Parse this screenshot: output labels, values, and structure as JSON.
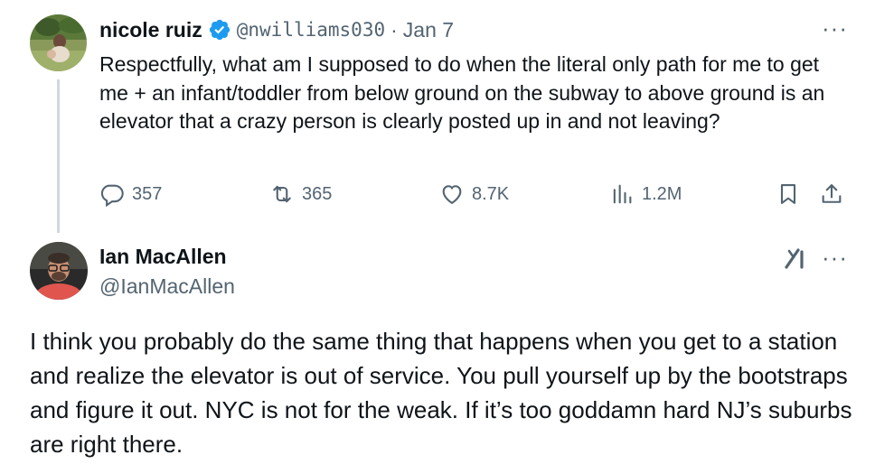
{
  "tweet1": {
    "author_name": "nicole ruiz",
    "author_handle": "@nwilliams030",
    "separator": "·",
    "date": "Jan 7",
    "more": "···",
    "text": "Respectfully, what am I supposed to do when the literal only path for me to get me + an infant/toddler from below ground on the subway to above ground is an elevator that a crazy person is clearly posted up in and not leaving?",
    "replies": "357",
    "reposts": "365",
    "likes": "8.7K",
    "views": "1.2M"
  },
  "tweet2": {
    "author_name": "Ian MacAllen",
    "author_handle": "@IanMacAllen",
    "more": "···",
    "text": "I think you probably do the same thing that happens when you get to a station and realize the elevator is out of service. You pull yourself up by the bootstraps and figure it out. NYC is not for the weak. If it’s too goddamn hard NJ’s suburbs are right there."
  },
  "colors": {
    "text_primary": "#0f1419",
    "text_secondary": "#536471",
    "verified_blue": "#1d9bf0",
    "thread_line": "#cfd9de"
  },
  "icons": [
    "verified-badge-icon",
    "reply-icon",
    "repost-icon",
    "like-icon",
    "views-icon",
    "bookmark-icon",
    "share-icon",
    "grok-icon",
    "more-icon"
  ]
}
